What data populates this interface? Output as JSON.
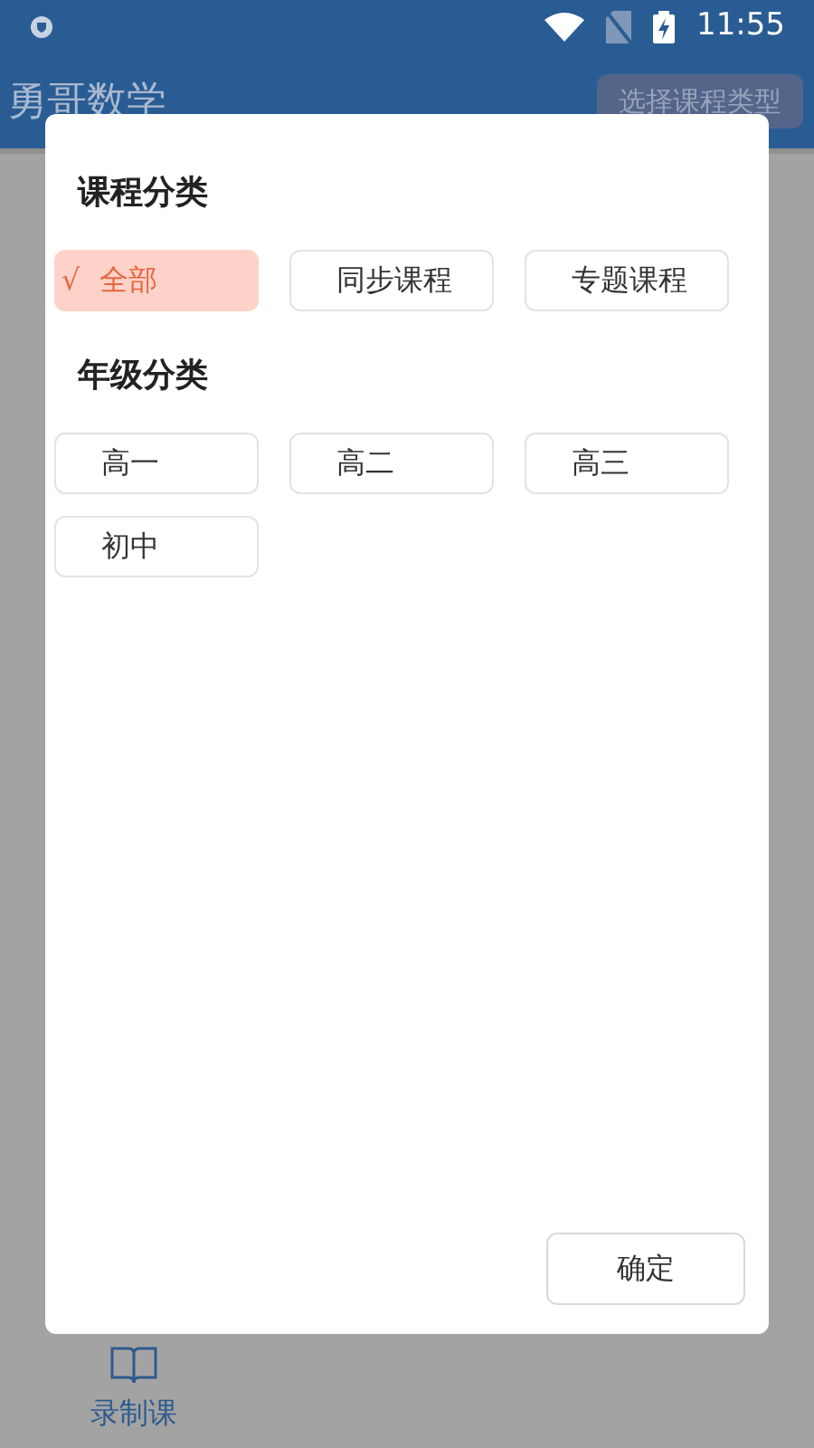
{
  "status_bar": {
    "time": "11:55"
  },
  "app_bar": {
    "title": "勇哥数学",
    "action": "选择课程类型"
  },
  "dialog": {
    "sections": [
      {
        "title": "课程分类",
        "options": [
          {
            "label": "全部",
            "selected": true,
            "mark": "√"
          },
          {
            "label": "同步课程",
            "selected": false
          },
          {
            "label": "专题课程",
            "selected": false
          }
        ]
      },
      {
        "title": "年级分类",
        "options": [
          {
            "label": "高一",
            "selected": false
          },
          {
            "label": "高二",
            "selected": false
          },
          {
            "label": "高三",
            "selected": false
          },
          {
            "label": "初中",
            "selected": false
          }
        ]
      }
    ],
    "confirm": "确定"
  },
  "bottom_nav": [
    {
      "label": "录制课",
      "selected": true
    }
  ]
}
